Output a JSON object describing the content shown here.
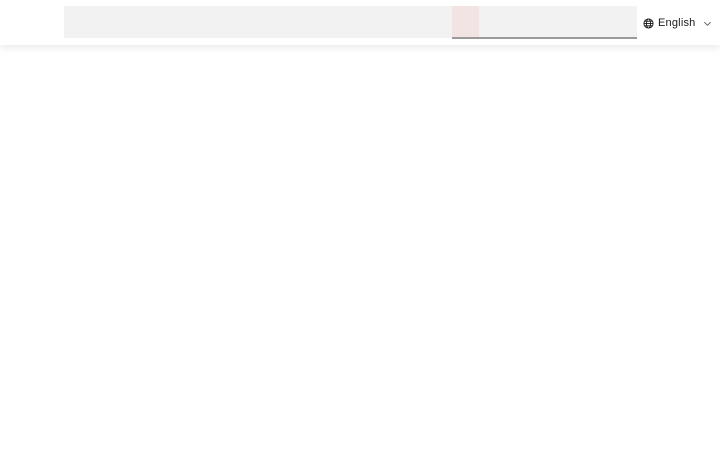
{
  "header": {
    "search": {
      "placeholder": "",
      "value": ""
    },
    "language": {
      "icon": "globe-icon",
      "selected": "English",
      "dropdown_icon": "chevron-down-icon"
    }
  },
  "colors": {
    "search_bg": "#f2f2f2",
    "search_accent": "#f3e4e4",
    "underline": "#9a9a9a",
    "text": "#1a1a1a"
  }
}
